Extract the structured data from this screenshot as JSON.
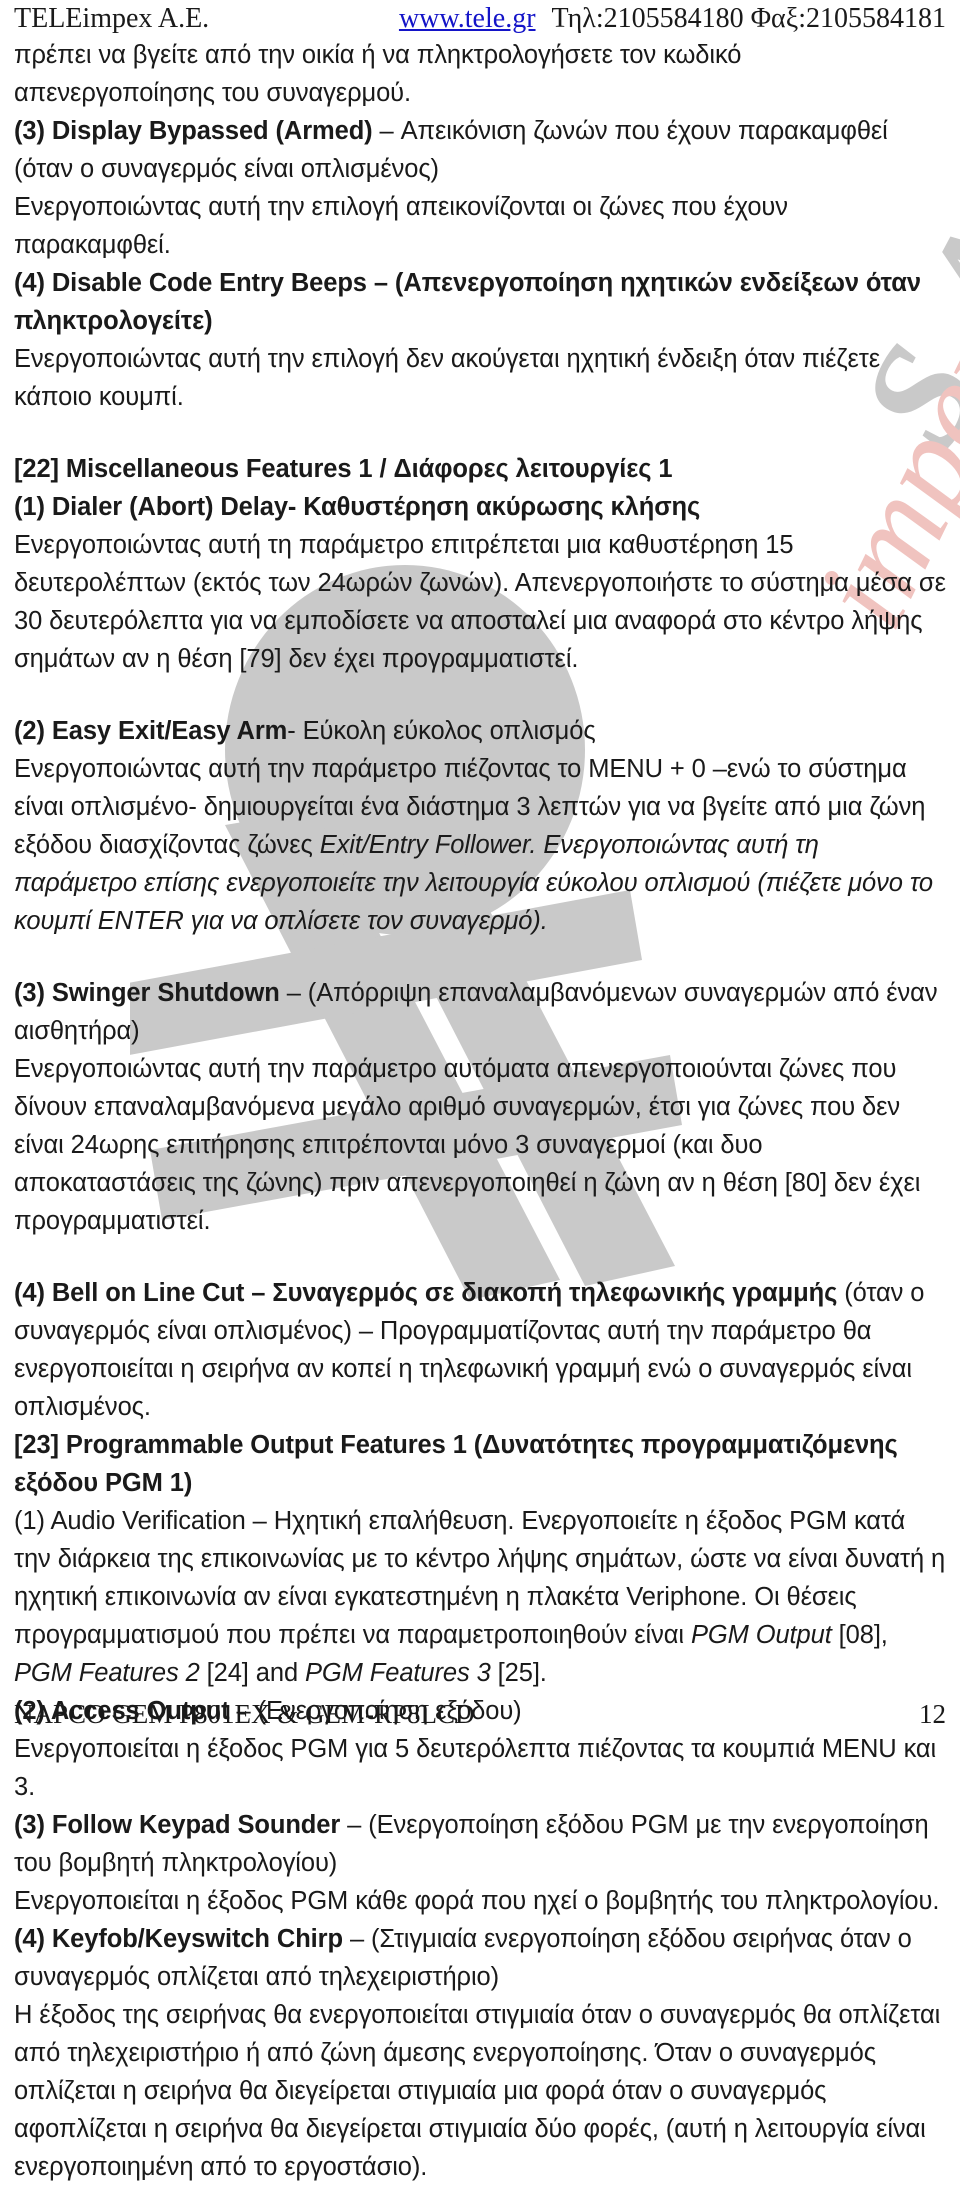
{
  "header": {
    "company": "TELEimpex A.E.",
    "website": "www.tele.gr",
    "contact": "Τηλ:2105584180 Φαξ:2105584181"
  },
  "watermarks": {
    "script_text": "impex",
    "initials_text": "S.A.",
    "script_color": "#f0c3bf",
    "gray_color": "#c9c9c9"
  },
  "body": {
    "continued_paragraph": "πρέπει να βγείτε από την οικία ή να πληκτρολογήσετε τον κωδικό απενεργοποίησης του συναγερμού.",
    "item_display_bypassed": {
      "heading_bold": "(3) Display Bypassed (Armed)",
      "heading_rest": " – Απεικόνιση ζωνών που έχουν παρακαμφθεί (όταν ο συναγερμός είναι οπλισμένος)",
      "text": "Ενεργοποιώντας αυτή την επιλογή απεικονίζονται οι ζώνες που έχουν παρακαμφθεί."
    },
    "item_disable_code_beeps": {
      "heading_bold": "(4) Disable Code Entry Beeps – (Απενεργοποίηση ηχητικών ενδείξεων όταν πληκτρολογείτε)",
      "text": "Ενεργοποιώντας αυτή την επιλογή δεν ακούγεται ηχητική ένδειξη όταν πιέζετε κάποιο κουμπί."
    },
    "section_22": {
      "title": "[22] Miscellaneous Features 1 / Διάφορες λειτουργίες 1",
      "item_1": {
        "heading_bold": "(1) Dialer (Abort) Delay- Καθυστέρηση ακύρωσης  κλήσης",
        "text": "Ενεργοποιώντας αυτή τη παράμετρο επιτρέπεται μια καθυστέρηση 15 δευτερολέπτων (εκτός των 24ωρών ζωνών). Απενεργοποιήστε το σύστημα μέσα σε 30 δευτερόλεπτα για να εμποδίσετε να αποσταλεί μια αναφορά στο κέντρο λήψης σημάτων αν η θέση [79] δεν έχει προγραμματιστεί."
      },
      "item_2": {
        "heading_bold": "(2) Easy Exit/Easy Arm",
        "heading_rest": "- Εύκολη  εύκολος οπλισμός",
        "text_part1": "Ενεργοποιώντας  αυτή την παράμετρο πιέζοντας το MENU + 0 –ενώ το σύστημα είναι οπλισμένο- δημιουργείται ένα διάστημα 3 λεπτών για να βγείτε  από μια ζώνη εξόδου διασχίζοντας ζώνες  ",
        "text_italic1": "Exit/Entry  Follower. Ενεργοποιώντας αυτή τη παράμετρο επίσης ενεργοποιείτε την λειτουργία εύκολου οπλισμού (πιέζετε μόνο  το κουμπί ENTER για να οπλίσετε τον συναγερμό)."
      },
      "item_3": {
        "heading_bold": "(3) Swinger Shutdown",
        "heading_rest": " – (Απόρριψη επαναλαμβανόμενων συναγερμών από έναν αισθητήρα)",
        "text": "Ενεργοποιώντας αυτή την παράμετρο αυτόματα απενεργοποιούνται ζώνες που δίνουν επαναλαμβανόμενα μεγάλο αριθμό συναγερμών,  έτσι για ζώνες που δεν είναι 24ωρης επιτήρησης επιτρέπονται μόνο 3 συναγερμοί (και δυο αποκαταστάσεις της ζώνης) πριν απενεργοποιηθεί η ζώνη αν η θέση [80] δεν έχει προγραμματιστεί."
      },
      "item_4": {
        "heading_bold": "(4) Bell on Line Cut – Συναγερμός σε διακοπή τηλεφωνικής γραμμής",
        "heading_rest": "  (όταν ο συναγερμός είναι οπλισμένος) – Προγραμματίζοντας αυτή την παράμετρο θα ενεργοποιείται η σειρήνα αν κοπεί η τηλεφωνική γραμμή ενώ ο συναγερμός είναι οπλισμένος."
      }
    },
    "section_23": {
      "title": " [23] Programmable Output Features 1 (Δυνατότητες προγραμματιζόμενης εξόδου PGM 1)",
      "item_1": {
        "heading_plain": "(1) Audio Verification – Ηχητική επαλήθευση. Ενεργοποιείτε η έξοδος PGM κατά την διάρκεια της επικοινωνίας με το κέντρο λήψης σημάτων, ώστε να είναι δυνατή η ηχητική επικοινωνία αν είναι εγκατεστημένη η πλακέτα Veriphone. Οι θέσεις προγραμματισμού που πρέπει να παραμετροποιηθούν είναι ",
        "ref1": "PGM  Output",
        "ref1_after": " [08], ",
        "ref2": "PGM  Features  2",
        "ref2_after": " [24] and ",
        "ref3": "PGM Features 3",
        "ref3_after": " [25]."
      },
      "item_2": {
        "heading_bold": "(2) Access Output",
        "heading_rest": " – (Ενεργοποίηση εξόδου)",
        "text": " Ενεργοποιείται η έξοδος PGM για 5 δευτερόλεπτα πιέζοντας τα κουμπιά MENU και 3."
      },
      "item_3": {
        "heading_bold": "(3) Follow Keypad Sounder",
        "heading_rest": " – (Ενεργοποίηση εξόδου PGM με την ενεργοποίηση του βομβητή πληκτρολογίου)",
        "text": "Ενεργοποιείται η έξοδος PGM κάθε φορά που ηχεί ο βομβητής του πληκτρολογίου."
      },
      "item_4": {
        "heading_bold": "(4) Keyfob/Keyswitch Chirp",
        "heading_rest": " – (Στιγμιαία ενεργοποίηση εξόδου σειρήνας όταν ο συναγερμός οπλίζεται από τηλεχειριστήριο)",
        "text": "Η έξοδος της σειρήνας θα ενεργοποιείται στιγμιαία όταν ο συναγερμός θα οπλίζεται από τηλεχειριστήριο ή από ζώνη άμεσης ενεργοποίησης. Όταν ο συναγερμός οπλίζεται η σειρήνα θα διεγείρεται στιγμιαία μια φορά όταν ο συναγερμός αφοπλίζεται  η σειρήνα θα διεγείρεται στιγμιαία δύο φορές, (αυτή η λειτουργία είναι ενεργοποιημένη από το εργοστάσιο)."
      }
    }
  },
  "footer": {
    "model": "NAPCO GEM P801EX & GEM-RP8LCD",
    "page_number": "12"
  }
}
